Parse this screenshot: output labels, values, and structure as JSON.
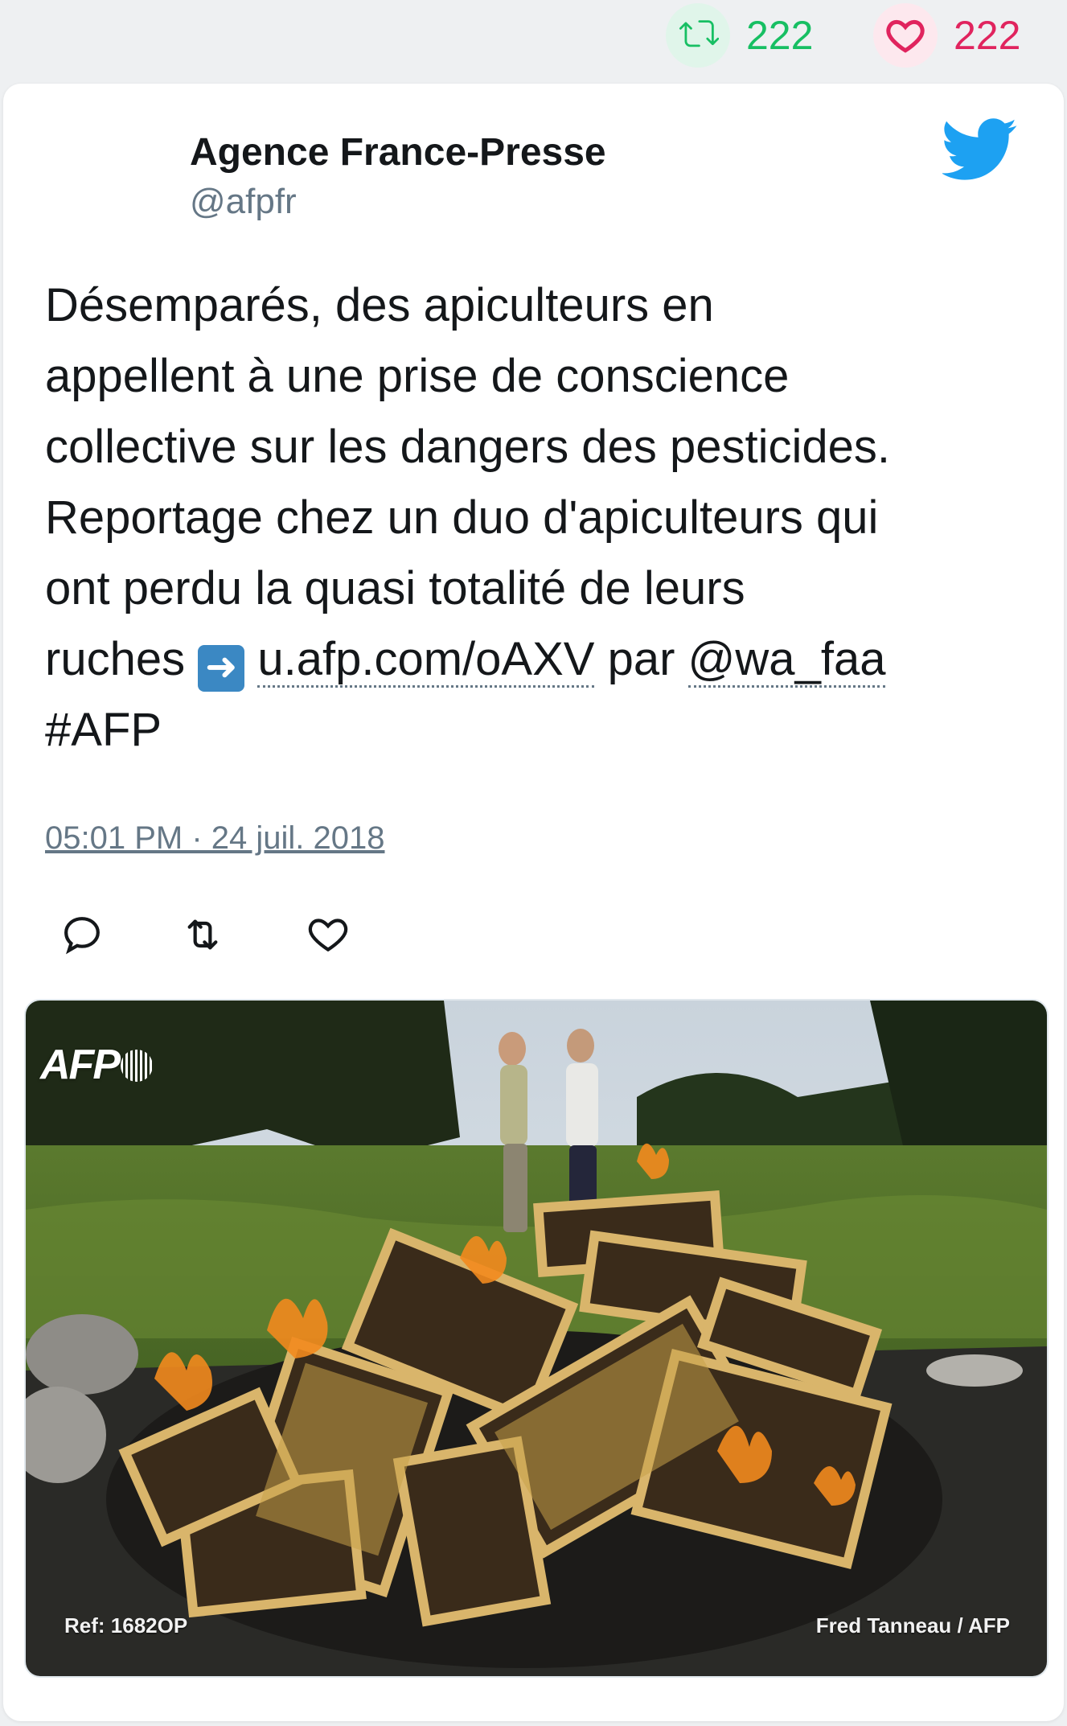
{
  "stats": {
    "retweet_count": "222",
    "like_count": "222",
    "retweet_color": "#17bf63",
    "like_color": "#e0245e"
  },
  "author": {
    "name": "Agence France-Presse",
    "handle": "@afpfr"
  },
  "tweet": {
    "lines": [
      "Désemparés, des apiculteurs en",
      "appellent à une prise de conscience",
      "collective sur les dangers des pesticides.",
      "Reportage chez un duo d'apiculteurs qui",
      "ont perdu la quasi totalité de leurs"
    ],
    "last_line_prefix": "ruches",
    "link_text": "u.afp.com/oAXV",
    "by_text": "par",
    "mention": "@wa_faa",
    "hashtag": "#AFP",
    "emoji": "➡️"
  },
  "timestamp": "05:01 PM · 24 juil. 2018",
  "actions": [
    "reply-icon",
    "retweet-icon",
    "like-icon"
  ],
  "media": {
    "logo": "AFP",
    "ref": "Ref: 1682OP",
    "credit": "Fred Tanneau / AFP"
  },
  "icons": {
    "twitter_bird_color": "#1da1f2"
  }
}
